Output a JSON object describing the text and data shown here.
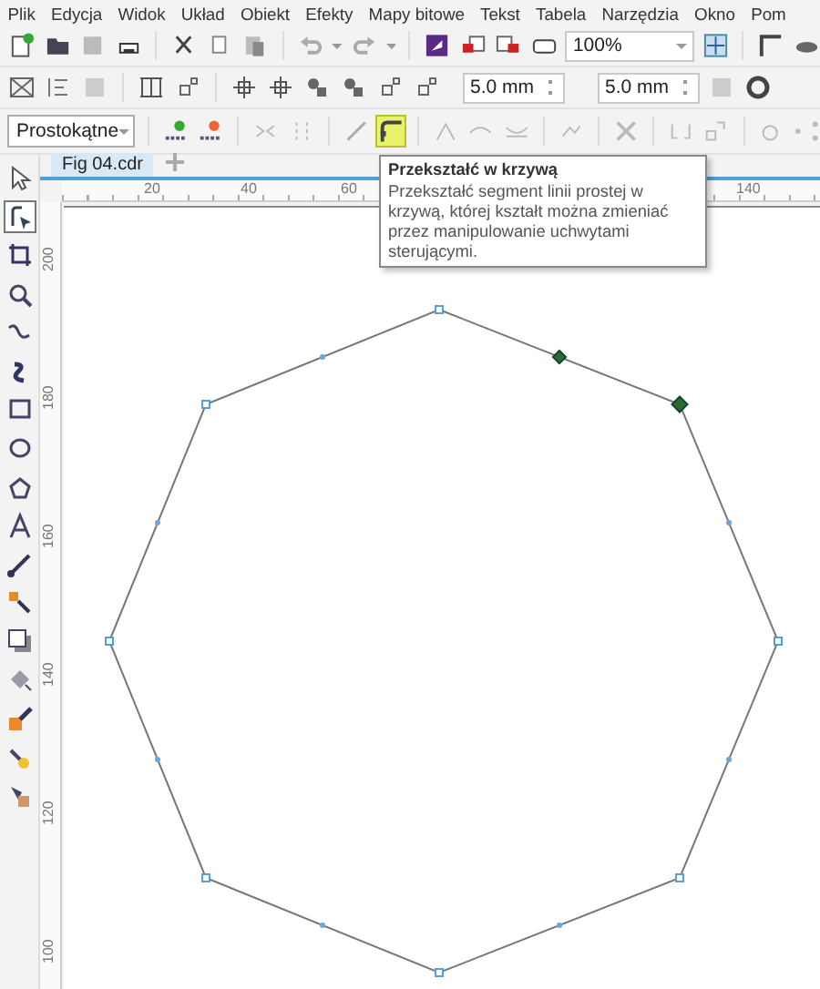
{
  "menu": [
    {
      "label": "Plik"
    },
    {
      "label": "Edycja"
    },
    {
      "label": "Widok"
    },
    {
      "label": "Układ"
    },
    {
      "label": "Obiekt"
    },
    {
      "label": "Efekty"
    },
    {
      "label": "Mapy bitowe"
    },
    {
      "label": "Tekst"
    },
    {
      "label": "Tabela"
    },
    {
      "label": "Narzędzia"
    },
    {
      "label": "Okno"
    },
    {
      "label": "Pom"
    }
  ],
  "standard_toolbar": {
    "zoom": "100%"
  },
  "nudge": {
    "offset_x": "5.0 mm",
    "offset_y": "5.0 mm"
  },
  "property_bar": {
    "curve_type": "Prostokątne",
    "convert_to_curve_highlighted": true
  },
  "document_tabs": [
    {
      "label": "Fig 04.cdr",
      "selected": true
    }
  ],
  "ruler": {
    "horizontal": [
      "20",
      "40",
      "60",
      "140"
    ],
    "vertical": [
      "200",
      "180",
      "160",
      "140",
      "120",
      "100"
    ]
  },
  "tools": [
    {
      "selected": false
    },
    {
      "selected": true
    },
    {
      "selected": false
    },
    {
      "selected": false
    },
    {
      "selected": false
    },
    {
      "selected": false
    },
    {
      "selected": false
    },
    {
      "selected": false
    },
    {
      "selected": false
    },
    {
      "selected": false
    },
    {
      "selected": false
    },
    {
      "selected": false
    },
    {
      "selected": false
    },
    {
      "selected": false
    },
    {
      "selected": false
    },
    {
      "selected": false
    },
    {
      "selected": false
    }
  ],
  "tooltip": {
    "title": "Przekształć w krzywą",
    "text": "Przekształć segment linii prostej w krzywą, której kształt można zmieniać przez manipulowanie uchwytami sterującymi."
  }
}
